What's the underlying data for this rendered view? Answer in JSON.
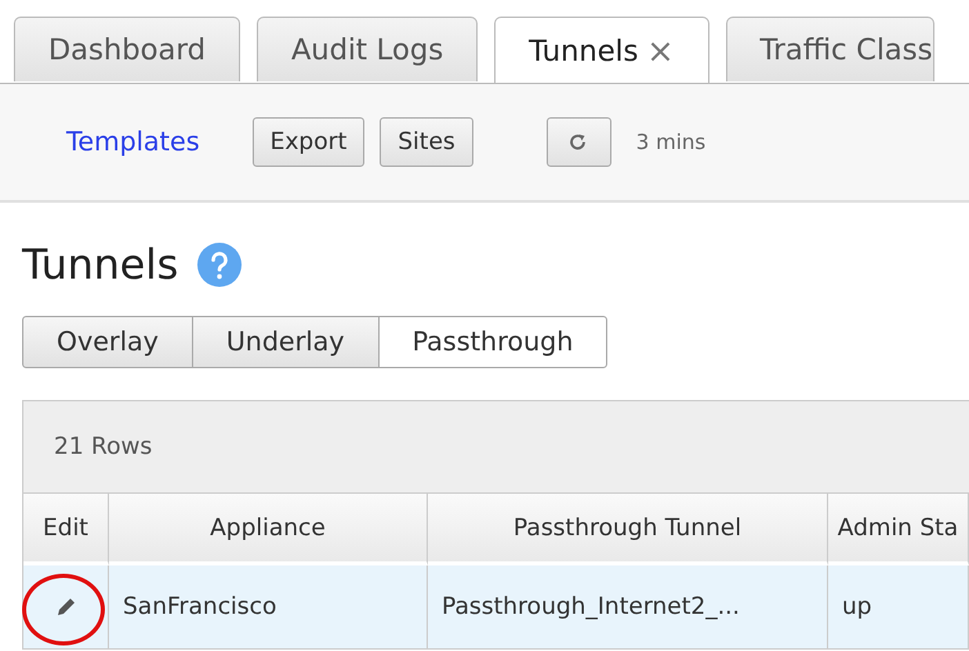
{
  "tabs": [
    {
      "label": "Dashboard",
      "selected": false,
      "closable": false
    },
    {
      "label": "Audit Logs",
      "selected": false,
      "closable": false
    },
    {
      "label": "Tunnels",
      "selected": true,
      "closable": true,
      "close_glyph": "×"
    },
    {
      "label": "Traffic Class",
      "selected": false,
      "closable": false
    }
  ],
  "toolbar": {
    "link": "Templates",
    "buttons": [
      "Export",
      "Sites"
    ],
    "refresh_age": "3 mins"
  },
  "page": {
    "title": "Tunnels"
  },
  "segments": [
    {
      "label": "Overlay",
      "selected": false
    },
    {
      "label": "Underlay",
      "selected": false
    },
    {
      "label": "Passthrough",
      "selected": true
    }
  ],
  "table": {
    "row_count": "21 Rows",
    "columns": [
      "Edit",
      "Appliance",
      "Passthrough Tunnel",
      "Admin Sta"
    ],
    "rows": [
      {
        "selected": true,
        "highlighted_edit": true,
        "cells": [
          "",
          "SanFrancisco",
          "Passthrough_Internet2_...",
          "up"
        ]
      }
    ]
  }
}
